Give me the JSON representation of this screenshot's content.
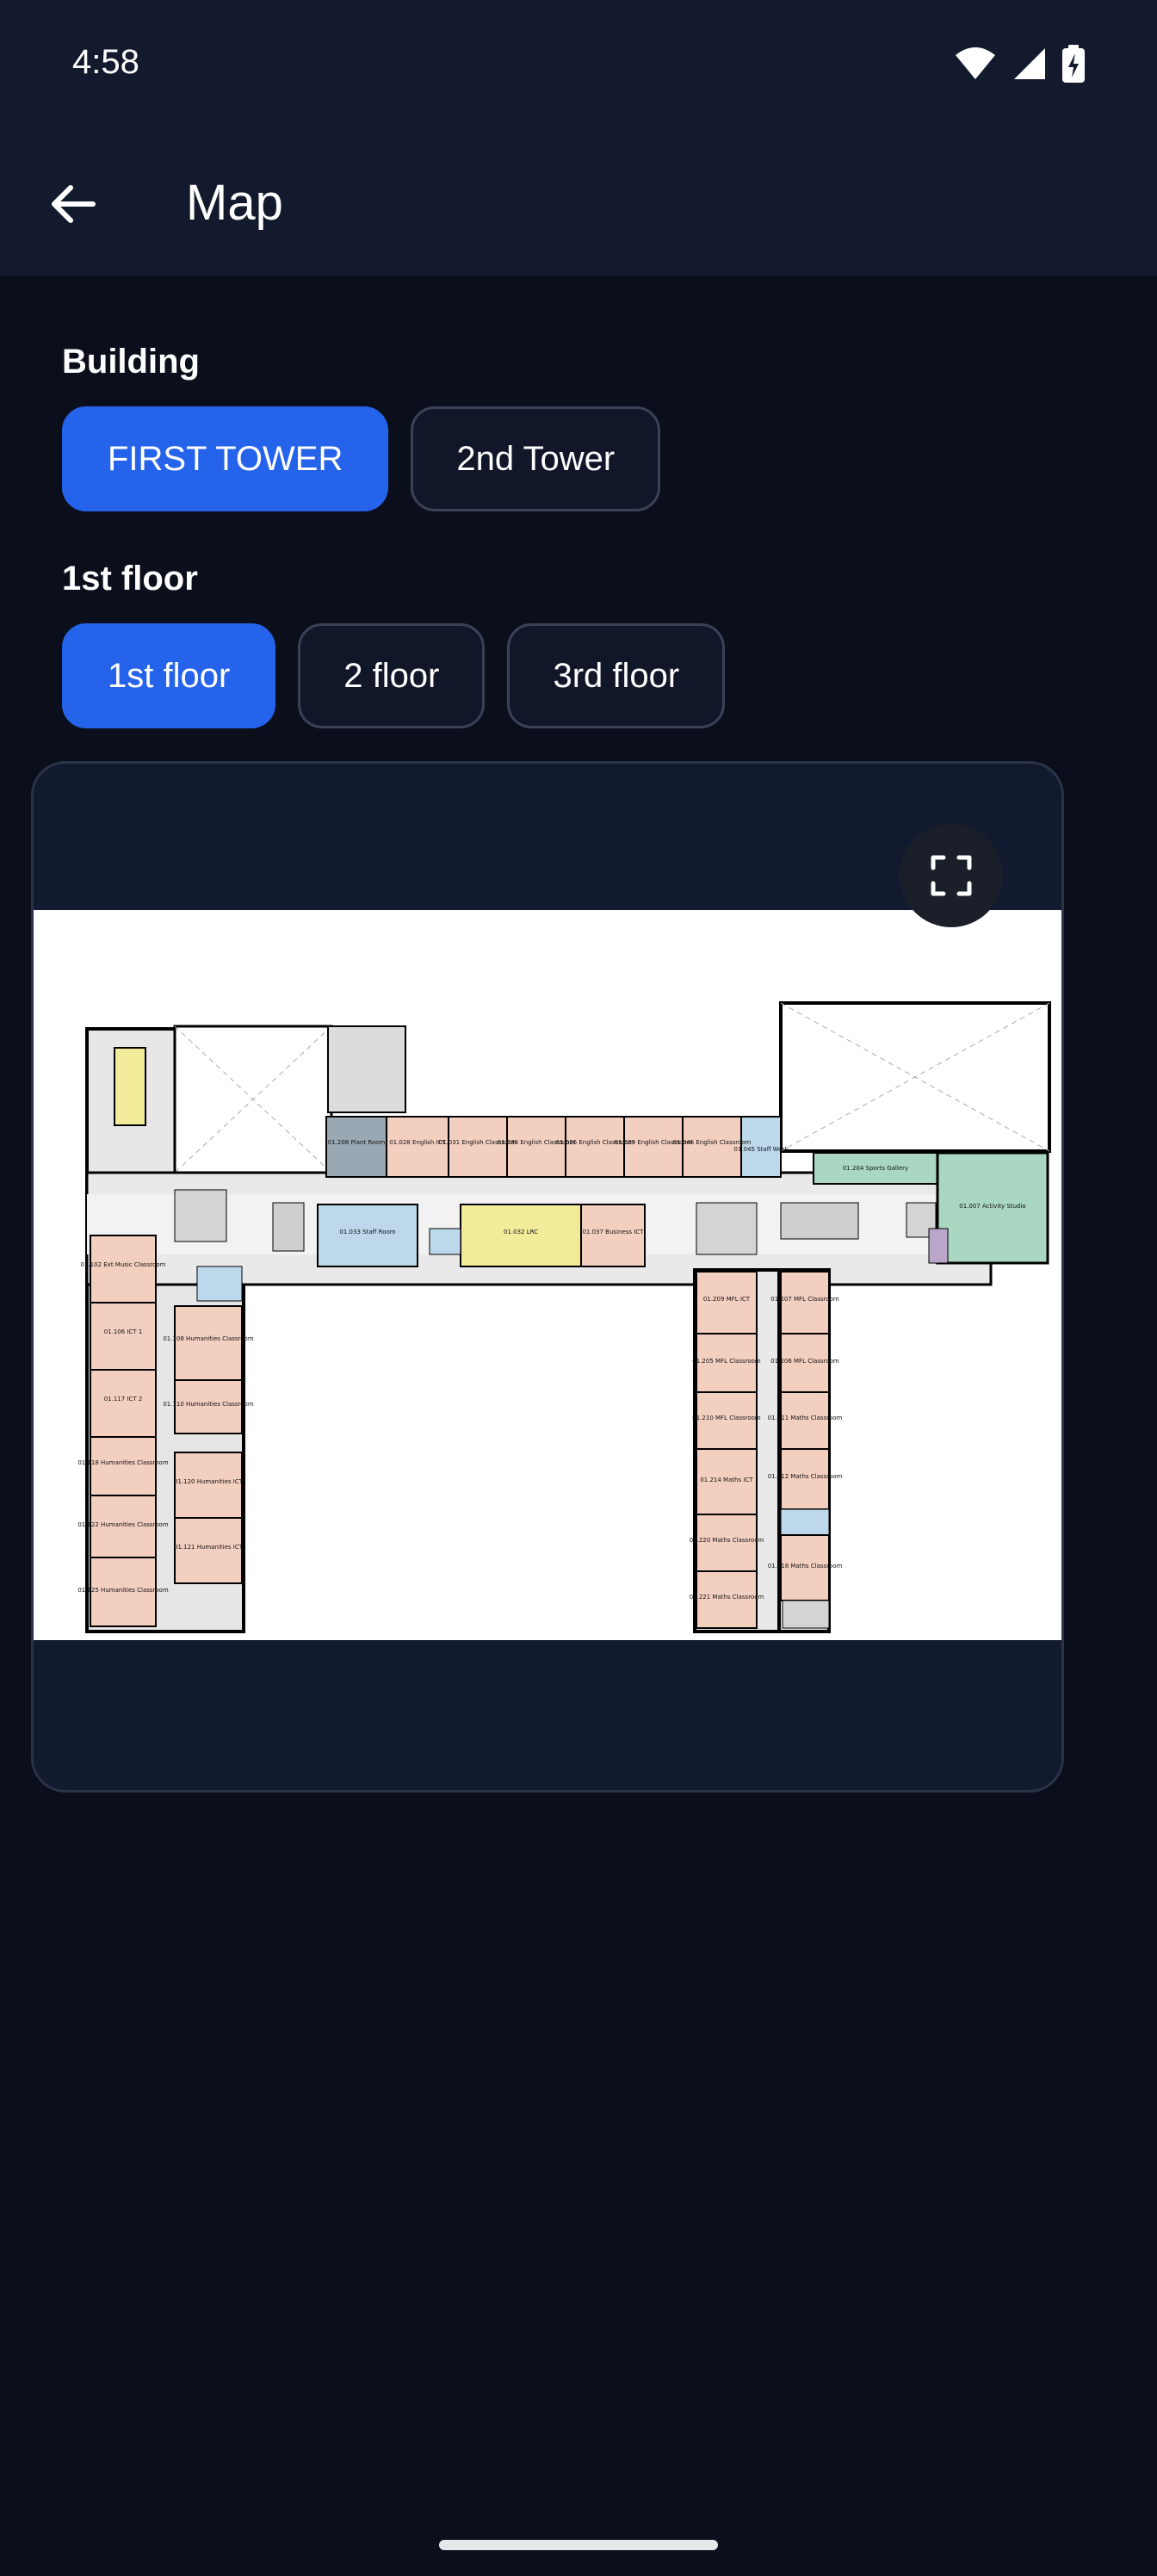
{
  "status_bar": {
    "time": "4:58"
  },
  "app_bar": {
    "title": "Map"
  },
  "building": {
    "label": "Building",
    "options": [
      {
        "label": "FIRST TOWER",
        "selected": true
      },
      {
        "label": "2nd Tower",
        "selected": false
      }
    ]
  },
  "floor": {
    "label": "1st floor",
    "options": [
      {
        "label": "1st floor",
        "selected": true
      },
      {
        "label": "2 floor",
        "selected": false
      },
      {
        "label": "3rd floor",
        "selected": false
      }
    ]
  },
  "map": {
    "fullscreen_icon": "fullscreen-icon",
    "rooms": {
      "r01_102": "01.102 Ext Music Classroom",
      "r01_106": "01.106 ICT 1",
      "r01_117": "01.117 ICT 2",
      "r01_118": "01.118 Humanities Classroom",
      "r01_122": "01.122 Humanities Classroom",
      "r01_125": "01.125 Humanities Classroom",
      "r01_108": "01.108 Humanities Classroom",
      "r01_110": "01.110 Humanities Classroom",
      "r01_120": "01.120 Humanities ICT",
      "r01_121": "01.121 Humanities ICT",
      "r01_033": "01.033 Staff Room",
      "r01_032": "01.032 LRC",
      "r01_037": "01.037 Business ICT",
      "r01_208": "01.208 Plant Room",
      "r01_028": "01.028 English ICT",
      "r01_031": "01.031 English Classroom",
      "r01_030": "01.030 English Classroom",
      "r01_026": "01.026 English Classroom",
      "r01_029": "01.029 English Classroom",
      "r01_046": "01.046 English Classroom",
      "r01_045": "01.045 Staff Work",
      "r01_204": "01.204 Sports Gallery",
      "r01_007": "01.007 Activity Studio",
      "r01_209": "01.209 MFL ICT",
      "r01_207": "01.207 MFL Classroom",
      "r01_205": "01.205 MFL Classroom",
      "r01_206": "01.206 MFL Classroom",
      "r01_210": "01.210 MFL Classroom",
      "r01_211": "01.211 Maths Classroom",
      "r01_214": "01.214 Maths ICT",
      "r01_212": "01.212 Maths Classroom",
      "r01_220": "01.220 Maths Classroom",
      "r01_218": "01.218 Maths Classroom",
      "r01_221": "01.221 Maths Classroom"
    }
  },
  "colors": {
    "accent": "#2563eb",
    "background": "#0b0f1c",
    "app_bar": "#131a2e",
    "classroom": "#f3cfc0",
    "staff": "#bcd8ea",
    "lrc": "#f2ec9a",
    "sports": "#a9d7c2"
  }
}
